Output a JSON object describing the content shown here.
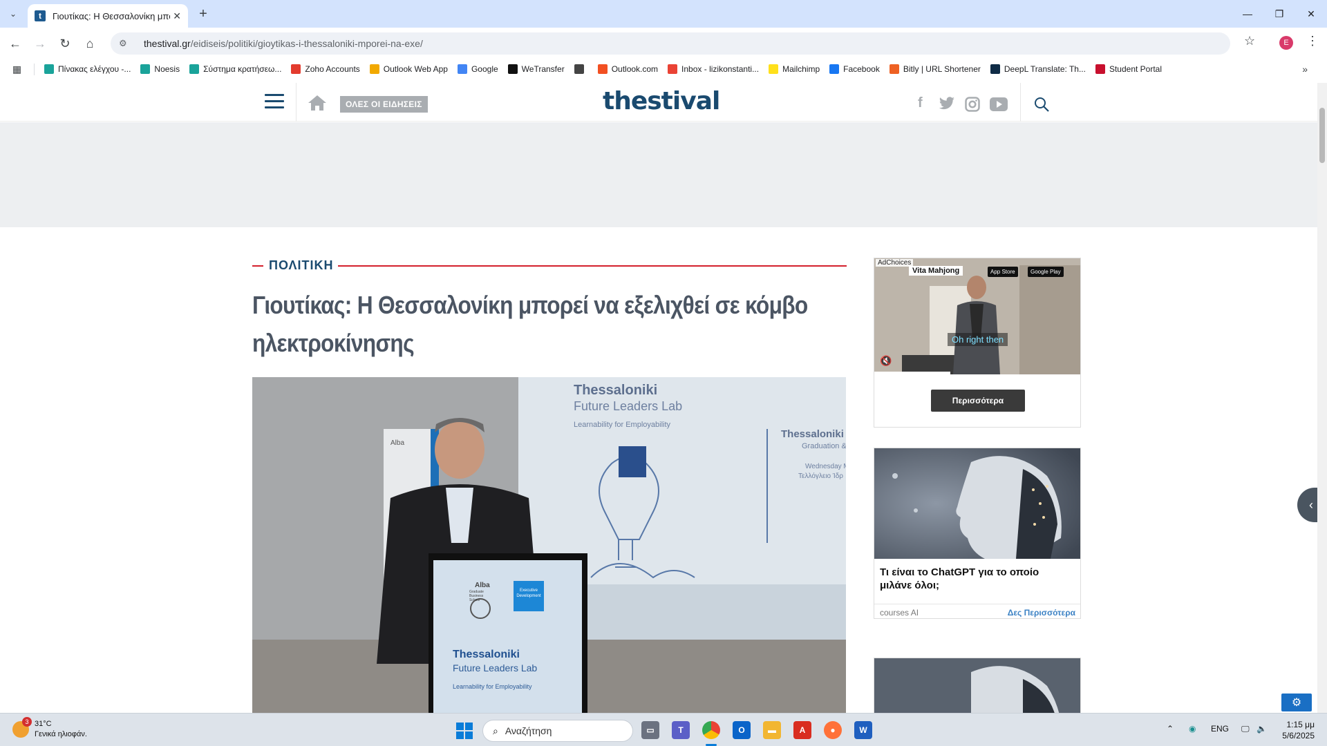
{
  "browser": {
    "tab_title": "Γιουτίκας: Η Θεσσαλονίκη μπο...",
    "tab_favicon_letter": "t",
    "url_domain": "thestival.gr",
    "url_path": "/eidiseis/politiki/gioytikas-i-thessaloniki-mporei-na-exe/",
    "profile_initial": "E"
  },
  "bookmarks": [
    {
      "label": "Πίνακας ελέγχου -...",
      "color": "#1aa39a"
    },
    {
      "label": "Noesis",
      "color": "#1aa39a"
    },
    {
      "label": "Σύστημα κρατήσεω...",
      "color": "#1aa39a"
    },
    {
      "label": "Zoho Accounts",
      "color": "#e33b2e"
    },
    {
      "label": "Outlook Web App",
      "color": "#f2a900"
    },
    {
      "label": "Google",
      "color": "#4285f4"
    },
    {
      "label": "WeTransfer",
      "color": "#111111"
    },
    {
      "label": "",
      "color": "#444444"
    },
    {
      "label": "Outlook.com",
      "color": "#f25022"
    },
    {
      "label": "Inbox - lizikonstanti...",
      "color": "#ea4335"
    },
    {
      "label": "Mailchimp",
      "color": "#ffe01b"
    },
    {
      "label": "Facebook",
      "color": "#1877f2"
    },
    {
      "label": "Bitly | URL Shortener",
      "color": "#ee6123"
    },
    {
      "label": "DeepL Translate: Th...",
      "color": "#0f2b46"
    },
    {
      "label": "Student Portal",
      "color": "#c8102e"
    }
  ],
  "site": {
    "logo": "thestival",
    "all_news_label": "ΟΛΕΣ ΟΙ ΕΙΔΗΣΕΙΣ",
    "brand_color": "#1a4a6f",
    "accent_color": "#d3202c"
  },
  "article": {
    "category": "ΠΟΛΙΤΙΚΗ",
    "headline": "Γιουτίκας: Η Θεσσαλονίκη μπορεί να εξελιχθεί σε κόμβο ηλεκτροκίνησης",
    "image": {
      "screen_title": "Thessaloniki",
      "screen_subtitle": "Future Leaders Lab",
      "screen_tagline": "Learnability for Employability",
      "screen_side_title": "Thessaloniki Fu",
      "screen_side_sub1": "Graduation &",
      "screen_side_sub2": "Wednesday M",
      "screen_side_sub3": "Τελλόγλειο Ίδρ",
      "banner_text": "Alba",
      "podium_logo": "Alba",
      "podium_logo_sub": "Graduate Business School",
      "podium_box": "Executive Development",
      "podium_title": "Thessaloniki",
      "podium_subtitle": "Future Leaders Lab",
      "podium_tagline": "Learnability for Employability"
    }
  },
  "sidebar": {
    "ad1": {
      "adchoices": "AdChoices",
      "app_name": "Vita Mahjong",
      "store1": "App Store",
      "store2": "Google Play",
      "caption": "Oh right then",
      "button": "Περισσότερα"
    },
    "ad2": {
      "title": "Τι είναι το ChatGPT για το οποίο μιλάνε όλοι;",
      "source": "courses AI",
      "more": "Δες Περισσότερα"
    }
  },
  "taskbar": {
    "weather_temp": "31°C",
    "weather_desc": "Γενικά ηλιοφάν.",
    "weather_badge": "3",
    "search_placeholder": "Αναζήτηση",
    "language": "ENG",
    "time": "1:15 μμ",
    "date": "5/6/2025"
  }
}
